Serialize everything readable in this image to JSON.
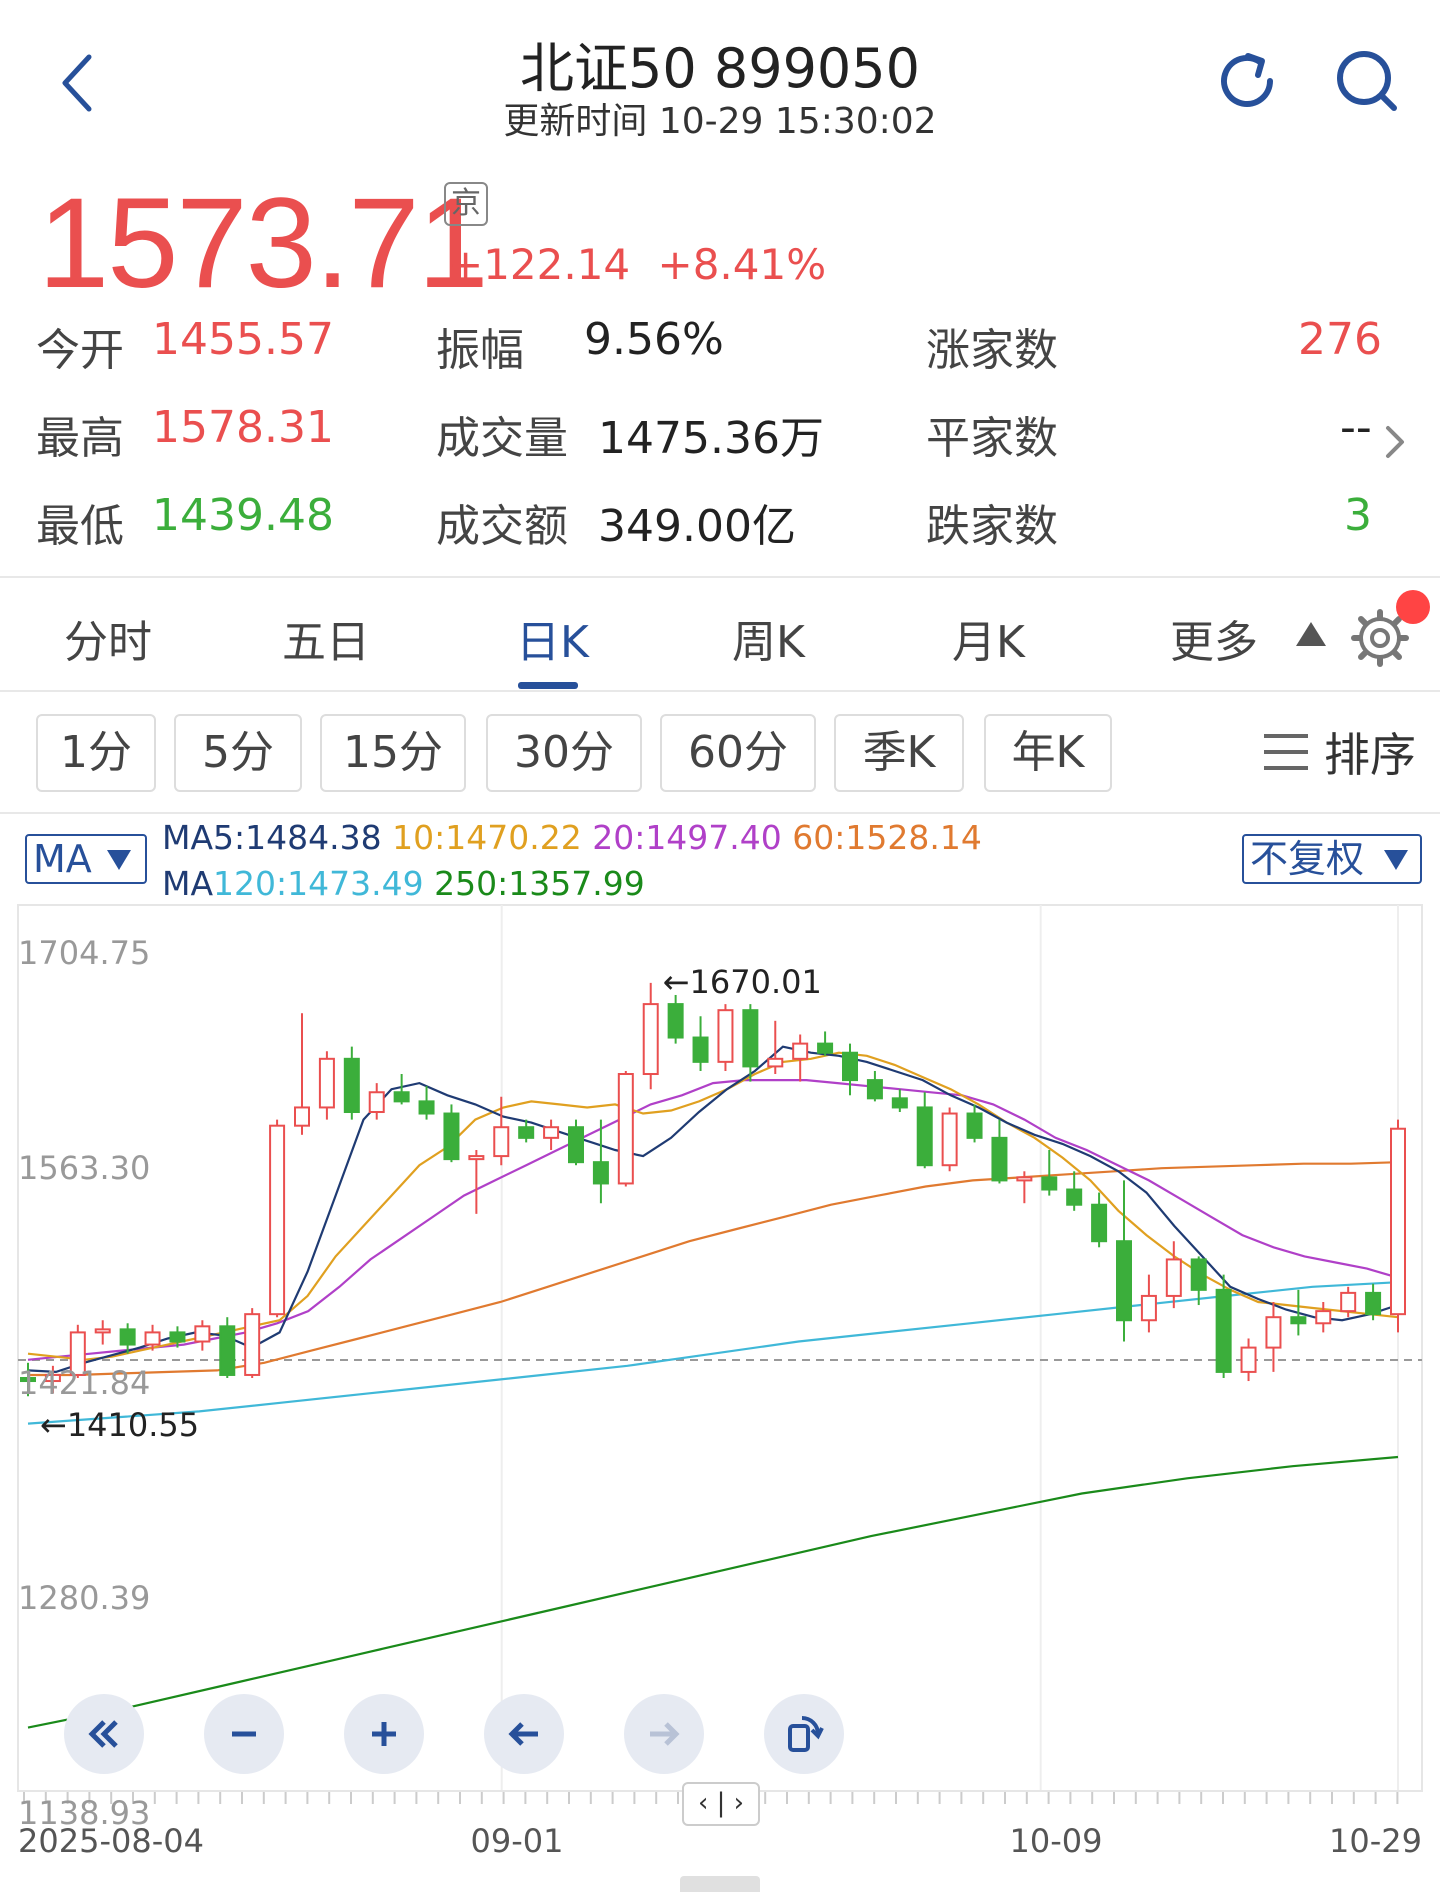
{
  "header": {
    "title": "北证50 899050",
    "update_time": "更新时间 10-29 15:30:02"
  },
  "quote": {
    "price": "1573.71",
    "exchange_badge": "京",
    "change": "+122.14",
    "change_pct": "+8.41%"
  },
  "stats": {
    "open_label": "今开",
    "open": "1455.57",
    "high_label": "最高",
    "high": "1578.31",
    "low_label": "最低",
    "low": "1439.48",
    "amplitude_label": "振幅",
    "amplitude": "9.56%",
    "volume_label": "成交量",
    "volume": "1475.36万",
    "turnover_label": "成交额",
    "turnover": "349.00亿",
    "up_label": "涨家数",
    "up": "276",
    "flat_label": "平家数",
    "flat": "--",
    "down_label": "跌家数",
    "down": "3"
  },
  "tabs": [
    "分时",
    "五日",
    "日K",
    "周K",
    "月K",
    "更多"
  ],
  "active_tab": "日K",
  "periods": [
    "1分",
    "5分",
    "15分",
    "30分",
    "60分",
    "季K",
    "年K"
  ],
  "sort_label": "排序",
  "ma": {
    "selector": "MA",
    "adjust": "不复权",
    "ma5": "MA5:1484.38",
    "ma10": "10:1470.22",
    "ma20": "20:1497.40",
    "ma60": "60:1528.14",
    "ma120_prefix": "MA",
    "ma120": "120:1473.49",
    "ma250": "250:1357.99"
  },
  "colors": {
    "up": "#ea4f4f",
    "down": "#3bae3b",
    "accent": "#27509a",
    "ma5": "#1f3b73",
    "ma10": "#e0a020",
    "ma20": "#b040c8",
    "ma60": "#e07a30",
    "ma120": "#40b8d8",
    "ma250": "#1a8a1a"
  },
  "icons": {
    "back": "chevron-left-icon",
    "refresh": "refresh-icon",
    "search": "search-icon",
    "settings": "gear-icon",
    "sort": "menu-icon"
  },
  "controls": [
    "rewind",
    "zoom-out",
    "zoom-in",
    "pan-left",
    "pan-right",
    "rotate"
  ],
  "pager_label": "‹ | ›",
  "chart_data": {
    "type": "candlestick",
    "y_ticks": [
      "1704.75",
      "1563.30",
      "1421.84",
      "1280.39",
      "1138.93"
    ],
    "x_ticks": [
      "2025-08-04",
      "09-01",
      "10-09",
      "10-29"
    ],
    "ylim": [
      1138.93,
      1704.75
    ],
    "max_annotation": "←1670.01",
    "min_annotation": "←1410.55",
    "reference_line": 1421.84,
    "candles": [
      [
        1410,
        1420,
        1398,
        1408
      ],
      [
        1408,
        1418,
        1400,
        1412
      ],
      [
        1412,
        1445,
        1410,
        1440
      ],
      [
        1440,
        1448,
        1432,
        1442
      ],
      [
        1442,
        1446,
        1426,
        1432
      ],
      [
        1432,
        1445,
        1428,
        1440
      ],
      [
        1440,
        1444,
        1430,
        1434
      ],
      [
        1434,
        1448,
        1428,
        1444
      ],
      [
        1444,
        1450,
        1410,
        1412
      ],
      [
        1412,
        1456,
        1410,
        1452
      ],
      [
        1452,
        1580,
        1450,
        1576
      ],
      [
        1576,
        1650,
        1570,
        1588
      ],
      [
        1588,
        1625,
        1580,
        1620
      ],
      [
        1620,
        1628,
        1580,
        1585
      ],
      [
        1585,
        1604,
        1580,
        1598
      ],
      [
        1598,
        1610,
        1590,
        1592
      ],
      [
        1592,
        1602,
        1580,
        1584
      ],
      [
        1584,
        1590,
        1552,
        1554
      ],
      [
        1554,
        1560,
        1518,
        1556
      ],
      [
        1556,
        1595,
        1550,
        1575
      ],
      [
        1575,
        1580,
        1565,
        1568
      ],
      [
        1568,
        1580,
        1560,
        1575
      ],
      [
        1575,
        1580,
        1550,
        1552
      ],
      [
        1552,
        1580,
        1525,
        1538
      ],
      [
        1538,
        1612,
        1536,
        1610
      ],
      [
        1610,
        1670,
        1600,
        1656
      ],
      [
        1656,
        1662,
        1630,
        1634
      ],
      [
        1634,
        1648,
        1612,
        1618
      ],
      [
        1618,
        1656,
        1612,
        1652
      ],
      [
        1652,
        1656,
        1605,
        1615
      ],
      [
        1615,
        1645,
        1610,
        1620
      ],
      [
        1620,
        1636,
        1605,
        1630
      ],
      [
        1630,
        1638,
        1622,
        1624
      ],
      [
        1624,
        1630,
        1596,
        1606
      ],
      [
        1606,
        1612,
        1592,
        1594
      ],
      [
        1594,
        1600,
        1585,
        1588
      ],
      [
        1588,
        1598,
        1548,
        1550
      ],
      [
        1550,
        1588,
        1546,
        1584
      ],
      [
        1584,
        1590,
        1565,
        1568
      ],
      [
        1568,
        1580,
        1538,
        1540
      ],
      [
        1540,
        1546,
        1525,
        1542
      ],
      [
        1542,
        1560,
        1530,
        1534
      ],
      [
        1534,
        1546,
        1520,
        1524
      ],
      [
        1524,
        1532,
        1496,
        1500
      ],
      [
        1500,
        1540,
        1434,
        1448
      ],
      [
        1448,
        1478,
        1440,
        1464
      ],
      [
        1464,
        1500,
        1456,
        1488
      ],
      [
        1488,
        1490,
        1458,
        1468
      ],
      [
        1468,
        1478,
        1410,
        1414
      ],
      [
        1414,
        1436,
        1408,
        1430
      ],
      [
        1430,
        1460,
        1414,
        1450
      ],
      [
        1450,
        1468,
        1438,
        1446
      ],
      [
        1446,
        1460,
        1440,
        1454
      ],
      [
        1454,
        1470,
        1450,
        1466
      ],
      [
        1466,
        1472,
        1448,
        1452
      ],
      [
        1452,
        1580,
        1440,
        1574
      ]
    ],
    "ma_series": {
      "ma5": [
        1415,
        1414,
        1420,
        1425,
        1430,
        1436,
        1440,
        1438,
        1430,
        1440,
        1480,
        1530,
        1580,
        1600,
        1604,
        1596,
        1590,
        1582,
        1578,
        1572,
        1566,
        1560,
        1556,
        1568,
        1585,
        1600,
        1612,
        1628,
        1624,
        1622,
        1618,
        1612,
        1606,
        1596,
        1588,
        1578,
        1570,
        1564,
        1556,
        1546,
        1532,
        1510,
        1490,
        1470,
        1462,
        1455,
        1450,
        1448,
        1452,
        1458
      ],
      "ma10": [
        1426,
        1424,
        1422,
        1424,
        1428,
        1432,
        1436,
        1440,
        1444,
        1448,
        1464,
        1490,
        1510,
        1530,
        1550,
        1562,
        1580,
        1588,
        1592,
        1590,
        1588,
        1590,
        1584,
        1586,
        1592,
        1600,
        1610,
        1618,
        1620,
        1624,
        1622,
        1616,
        1608,
        1600,
        1590,
        1578,
        1568,
        1555,
        1540,
        1520,
        1504,
        1490,
        1478,
        1468,
        1460,
        1458,
        1456,
        1454,
        1452,
        1450
      ],
      "ma20": [
        1422,
        1424,
        1426,
        1428,
        1430,
        1432,
        1436,
        1440,
        1446,
        1454,
        1470,
        1488,
        1502,
        1516,
        1530,
        1540,
        1550,
        1560,
        1570,
        1580,
        1590,
        1596,
        1604,
        1606,
        1606,
        1606,
        1604,
        1602,
        1600,
        1598,
        1596,
        1590,
        1580,
        1568,
        1560,
        1550,
        1540,
        1528,
        1516,
        1504,
        1496,
        1490,
        1486,
        1482,
        1476
      ],
      "ma60": [
        1412,
        1412,
        1413,
        1414,
        1415,
        1420,
        1428,
        1436,
        1444,
        1452,
        1460,
        1470,
        1480,
        1490,
        1500,
        1508,
        1516,
        1524,
        1530,
        1536,
        1540,
        1542,
        1544,
        1546,
        1548,
        1549,
        1550,
        1551,
        1551,
        1552
      ],
      "ma120": [
        1380,
        1384,
        1388,
        1394,
        1400,
        1406,
        1412,
        1418,
        1426,
        1434,
        1440,
        1446,
        1452,
        1458,
        1464,
        1470,
        1473
      ],
      "ma250": [
        1180,
        1194,
        1210,
        1226,
        1242,
        1258,
        1274,
        1290,
        1306,
        1320,
        1334,
        1344,
        1352,
        1358
      ]
    }
  }
}
